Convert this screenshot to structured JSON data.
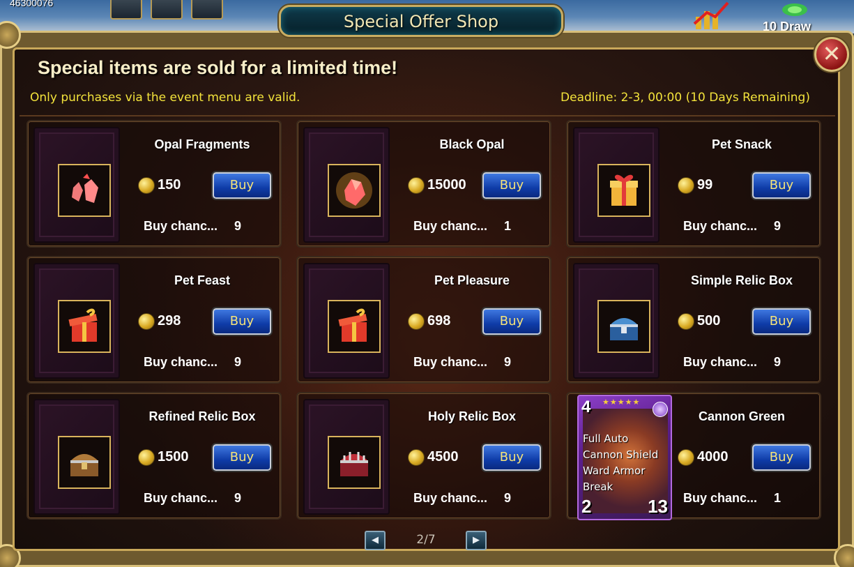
{
  "top_bar": {
    "gold_count": "46300076",
    "draw_label": "10 Draw"
  },
  "window": {
    "title": "Special Offer Shop",
    "close_label": "✕",
    "headline": "Special items are sold for a limited time!",
    "subline": "Only purchases via the event menu are valid.",
    "deadline": "Deadline: 2-3, 00:00 (10 Days Remaining)"
  },
  "items": [
    {
      "name": "Opal Fragments",
      "price": "150",
      "buy_label": "Buy",
      "chance_label": "Buy chanc...",
      "chance": "9",
      "icon": "opal-fragments-icon"
    },
    {
      "name": "Black Opal",
      "price": "15000",
      "buy_label": "Buy",
      "chance_label": "Buy chanc...",
      "chance": "1",
      "icon": "black-opal-icon"
    },
    {
      "name": "Pet Snack",
      "price": "99",
      "buy_label": "Buy",
      "chance_label": "Buy chanc...",
      "chance": "9",
      "icon": "gift-box-icon"
    },
    {
      "name": "Pet Feast",
      "price": "298",
      "buy_label": "Buy",
      "chance_label": "Buy chanc...",
      "chance": "9",
      "icon": "red-gift-icon"
    },
    {
      "name": "Pet Pleasure",
      "price": "698",
      "buy_label": "Buy",
      "chance_label": "Buy chanc...",
      "chance": "9",
      "icon": "red-gift-icon"
    },
    {
      "name": "Simple Relic Box",
      "price": "500",
      "buy_label": "Buy",
      "chance_label": "Buy chanc...",
      "chance": "9",
      "icon": "blue-chest-icon"
    },
    {
      "name": "Refined Relic Box",
      "price": "1500",
      "buy_label": "Buy",
      "chance_label": "Buy chanc...",
      "chance": "9",
      "icon": "wooden-chest-icon"
    },
    {
      "name": "Holy Relic Box",
      "price": "4500",
      "buy_label": "Buy",
      "chance_label": "Buy chanc...",
      "chance": "9",
      "icon": "red-chest-icon"
    },
    {
      "name": "Cannon Green",
      "price": "4000",
      "buy_label": "Buy",
      "chance_label": "Buy chanc...",
      "chance": "1",
      "icon": "hero-card-icon"
    }
  ],
  "hero_card": {
    "level": "4",
    "stars": "★★★★★",
    "skills": [
      "Full Auto",
      "Cannon Shield",
      "Ward Armor",
      "Break"
    ],
    "attack": "2",
    "hp": "13"
  },
  "pager": {
    "prev_label": "◀",
    "next_label": "▶",
    "page": "2/7"
  },
  "colors": {
    "accent_yellow": "#f3e33b",
    "button_blue": "#0f3ca8",
    "frame_gold": "#c9a85a"
  }
}
